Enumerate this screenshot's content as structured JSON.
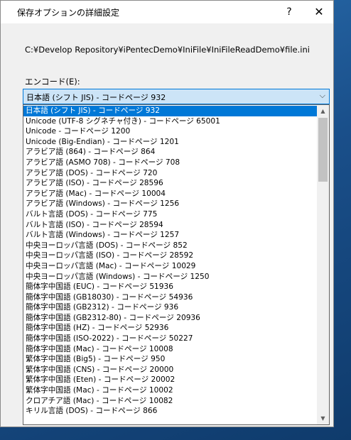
{
  "dialog": {
    "title": "保存オプションの詳細設定",
    "help_glyph": "?",
    "close_glyph": "✕"
  },
  "file_path": "C:¥Develop Repository¥iPentecDemo¥IniFile¥IniFileReadDemo¥file.ini",
  "encoding": {
    "label": "エンコード(E):",
    "selected": "日本語 (シフト JIS) - コードページ 932",
    "options": [
      "日本語 (シフト JIS) - コードページ 932",
      "Unicode (UTF-8 シグネチャ付き) - コードページ 65001",
      "Unicode - コードページ 1200",
      "Unicode (Big-Endian) - コードページ 1201",
      "アラビア語 (864) - コードページ 864",
      "アラビア語 (ASMO 708) - コードページ 708",
      "アラビア語 (DOS) - コードページ 720",
      "アラビア語 (ISO) - コードページ 28596",
      "アラビア語 (Mac) - コードページ 10004",
      "アラビア語 (Windows) - コードページ 1256",
      "バルト言語 (DOS) - コードページ 775",
      "バルト言語 (ISO) - コードページ 28594",
      "バルト言語 (Windows) - コードページ 1257",
      "中央ヨーロッパ言語 (DOS) - コードページ 852",
      "中央ヨーロッパ言語 (ISO) - コードページ 28592",
      "中央ヨーロッパ言語 (Mac) - コードページ 10029",
      "中央ヨーロッパ言語 (Windows) - コードページ 1250",
      "簡体字中国語 (EUC) - コードページ 51936",
      "簡体字中国語 (GB18030) - コードページ 54936",
      "簡体字中国語 (GB2312) - コードページ 936",
      "簡体字中国語 (GB2312-80) - コードページ 20936",
      "簡体字中国語 (HZ) - コードページ 52936",
      "簡体字中国語 (ISO-2022) - コードページ 50227",
      "簡体字中国語 (Mac) - コードページ 10008",
      "繁体字中国語 (Big5) - コードページ 950",
      "繁体字中国語 (CNS) - コードページ 20000",
      "繁体字中国語 (Eten) - コードページ 20002",
      "繁体字中国語 (Mac) - コードページ 10002",
      "クロアチア語 (Mac) - コードページ 10082",
      "キリル言語 (DOS) - コードページ 866"
    ]
  },
  "icons": {
    "combo_arrow": "chevron-down-icon",
    "scroll_up": "scroll-up-arrow-icon",
    "scroll_down": "scroll-down-arrow-icon"
  }
}
